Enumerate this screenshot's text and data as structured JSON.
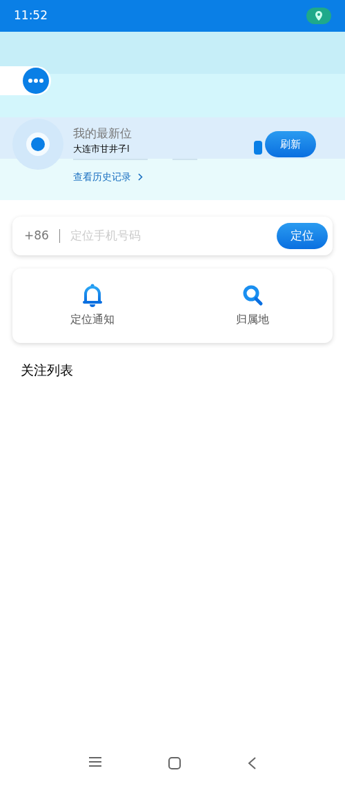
{
  "status_bar": {
    "time": "11:52"
  },
  "location_card": {
    "title": "我的最新位",
    "address": "大连市甘井子l",
    "history_link": "查看历史记录",
    "refresh_button": "刷新"
  },
  "phone_search": {
    "country_code": "+86",
    "placeholder": "定位手机号码",
    "button": "定位"
  },
  "actions": [
    {
      "kind": "bell",
      "label": "定位通知"
    },
    {
      "kind": "search",
      "label": "归属地"
    }
  ],
  "section_title": "关注列表"
}
